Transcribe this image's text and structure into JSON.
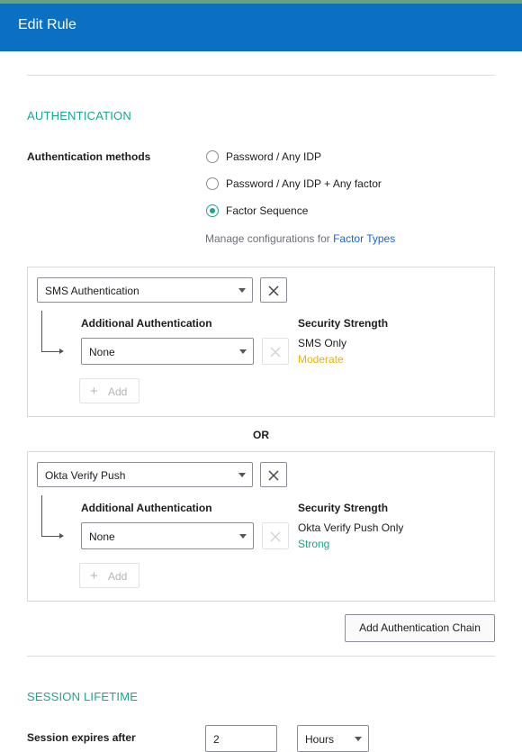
{
  "header": {
    "title": "Edit Rule"
  },
  "authentication": {
    "section_title": "AUTHENTICATION",
    "methods_label": "Authentication methods",
    "options": [
      {
        "label": "Password / Any IDP",
        "selected": false
      },
      {
        "label": "Password / Any IDP + Any factor",
        "selected": false
      },
      {
        "label": "Factor Sequence",
        "selected": true
      }
    ],
    "manage_text": "Manage configurations for",
    "manage_link": "Factor Types",
    "chains": [
      {
        "factor": "SMS Authentication",
        "additional_label": "Additional Authentication",
        "additional_value": "None",
        "add_label": "Add",
        "strength_label": "Security Strength",
        "strength_desc": "SMS Only",
        "strength_level": "Moderate"
      },
      {
        "factor": "Okta Verify Push",
        "additional_label": "Additional Authentication",
        "additional_value": "None",
        "add_label": "Add",
        "strength_label": "Security Strength",
        "strength_desc": "Okta Verify Push Only",
        "strength_level": "Strong"
      }
    ],
    "or_label": "OR",
    "add_chain_label": "Add Authentication Chain"
  },
  "session": {
    "section_title": "SESSION LIFETIME",
    "expires_label": "Session expires after",
    "expires_value": "2",
    "unit": "Hours"
  },
  "colors": {
    "header_bg": "#0b6fc2",
    "section_title": "#1aa68d",
    "link": "#1662dd",
    "moderate": "#e8b20d",
    "strong": "#1aa68d"
  }
}
